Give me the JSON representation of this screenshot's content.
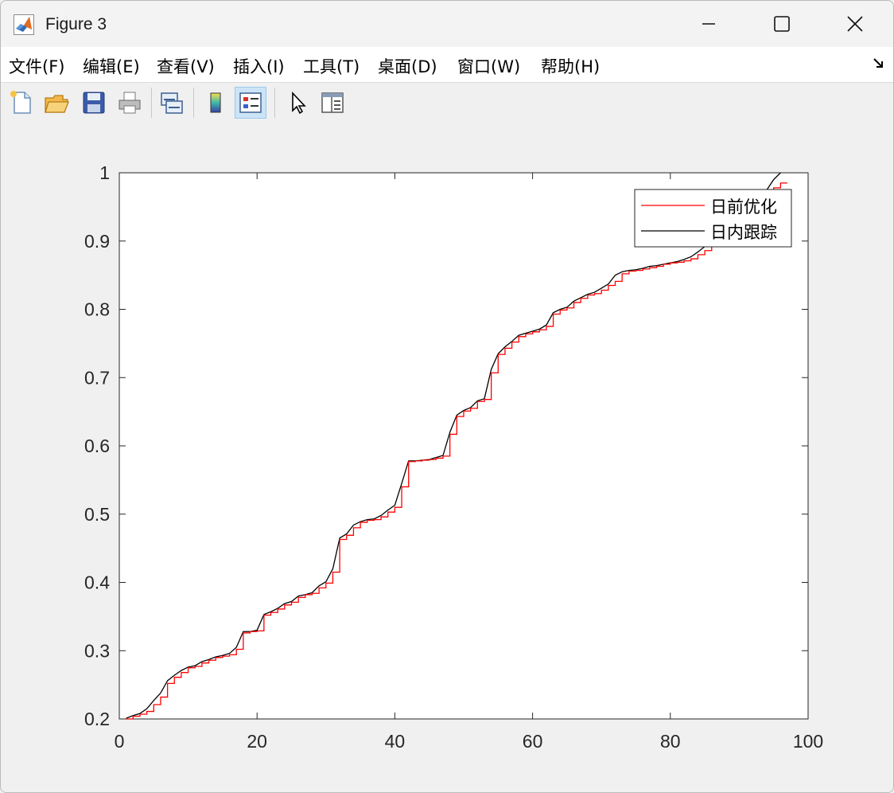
{
  "window": {
    "title": "Figure 3",
    "minimize_icon": "minimize-icon",
    "maximize_icon": "maximize-icon",
    "close_icon": "close-icon"
  },
  "menubar": {
    "items": [
      "文件(F)",
      "编辑(E)",
      "查看(V)",
      "插入(I)",
      "工具(T)",
      "桌面(D)",
      "窗口(W)",
      "帮助(H)"
    ]
  },
  "toolbar": {
    "icons": [
      "new-figure-icon",
      "open-file-icon",
      "save-icon",
      "print-icon",
      "link-plot-icon",
      "colorbar-icon",
      "legend-icon",
      "edit-plot-icon",
      "property-inspector-icon"
    ]
  },
  "chart_data": {
    "type": "line",
    "xlim": [
      0,
      100
    ],
    "ylim": [
      0.2,
      1
    ],
    "xticks": [
      "0",
      "20",
      "40",
      "60",
      "80",
      "100"
    ],
    "yticks": [
      "0.2",
      "0.3",
      "0.4",
      "0.5",
      "0.6",
      "0.7",
      "0.8",
      "0.9",
      "1"
    ],
    "grid": false,
    "legend_position": "top-right",
    "series": [
      {
        "name": "日前优化",
        "color": "#ff0000",
        "style": "stairs",
        "x": [
          1,
          2,
          3,
          4,
          5,
          6,
          7,
          8,
          9,
          10,
          11,
          12,
          13,
          14,
          15,
          16,
          17,
          18,
          19,
          20,
          21,
          22,
          23,
          24,
          25,
          26,
          27,
          28,
          29,
          30,
          31,
          32,
          33,
          34,
          35,
          36,
          37,
          38,
          39,
          40,
          41,
          42,
          43,
          44,
          45,
          46,
          47,
          48,
          49,
          50,
          51,
          52,
          53,
          54,
          55,
          56,
          57,
          58,
          59,
          60,
          61,
          62,
          63,
          64,
          65,
          66,
          67,
          68,
          69,
          70,
          71,
          72,
          73,
          74,
          75,
          76,
          77,
          78,
          79,
          80,
          81,
          82,
          83,
          84,
          85,
          86,
          87,
          88,
          89,
          90,
          91,
          92,
          93,
          94,
          95,
          96
        ],
        "values": [
          0.2,
          0.204,
          0.207,
          0.211,
          0.221,
          0.232,
          0.252,
          0.261,
          0.268,
          0.275,
          0.277,
          0.282,
          0.286,
          0.29,
          0.292,
          0.294,
          0.302,
          0.326,
          0.328,
          0.329,
          0.352,
          0.356,
          0.361,
          0.367,
          0.371,
          0.378,
          0.382,
          0.384,
          0.392,
          0.399,
          0.415,
          0.463,
          0.469,
          0.48,
          0.488,
          0.491,
          0.492,
          0.496,
          0.503,
          0.51,
          0.54,
          0.577,
          0.578,
          0.579,
          0.58,
          0.582,
          0.585,
          0.617,
          0.643,
          0.651,
          0.655,
          0.665,
          0.668,
          0.707,
          0.734,
          0.743,
          0.752,
          0.76,
          0.764,
          0.767,
          0.77,
          0.775,
          0.793,
          0.799,
          0.802,
          0.81,
          0.816,
          0.821,
          0.823,
          0.828,
          0.835,
          0.841,
          0.852,
          0.856,
          0.857,
          0.859,
          0.861,
          0.863,
          0.866,
          0.868,
          0.869,
          0.871,
          0.874,
          0.88,
          0.886,
          0.893,
          0.9,
          0.91,
          0.918,
          0.926,
          0.935,
          0.945,
          0.954,
          0.966,
          0.978,
          0.985
        ]
      },
      {
        "name": "日内跟踪",
        "color": "#000000",
        "style": "line",
        "x": [
          1,
          2,
          3,
          4,
          5,
          6,
          7,
          8,
          9,
          10,
          11,
          12,
          13,
          14,
          15,
          16,
          17,
          18,
          19,
          20,
          21,
          22,
          23,
          24,
          25,
          26,
          27,
          28,
          29,
          30,
          31,
          32,
          33,
          34,
          35,
          36,
          37,
          38,
          39,
          40,
          41,
          42,
          43,
          44,
          45,
          46,
          47,
          48,
          49,
          50,
          51,
          52,
          53,
          54,
          55,
          56,
          57,
          58,
          59,
          60,
          61,
          62,
          63,
          64,
          65,
          66,
          67,
          68,
          69,
          70,
          71,
          72,
          73,
          74,
          75,
          76,
          77,
          78,
          79,
          80,
          81,
          82,
          83,
          84,
          85,
          86,
          87,
          88,
          89,
          90,
          91,
          92,
          93,
          94,
          95,
          96
        ],
        "values": [
          0.201,
          0.205,
          0.208,
          0.215,
          0.227,
          0.238,
          0.256,
          0.264,
          0.271,
          0.276,
          0.278,
          0.284,
          0.287,
          0.291,
          0.293,
          0.296,
          0.305,
          0.328,
          0.328,
          0.33,
          0.353,
          0.357,
          0.362,
          0.369,
          0.372,
          0.38,
          0.382,
          0.385,
          0.395,
          0.401,
          0.42,
          0.465,
          0.471,
          0.484,
          0.489,
          0.492,
          0.493,
          0.498,
          0.506,
          0.513,
          0.545,
          0.578,
          0.578,
          0.579,
          0.58,
          0.583,
          0.586,
          0.62,
          0.645,
          0.652,
          0.656,
          0.666,
          0.669,
          0.712,
          0.735,
          0.745,
          0.753,
          0.762,
          0.765,
          0.768,
          0.771,
          0.777,
          0.795,
          0.8,
          0.803,
          0.812,
          0.817,
          0.822,
          0.825,
          0.831,
          0.837,
          0.85,
          0.855,
          0.857,
          0.858,
          0.86,
          0.863,
          0.864,
          0.866,
          0.868,
          0.87,
          0.873,
          0.877,
          0.884,
          0.892,
          0.899,
          0.908,
          0.917,
          0.925,
          0.934,
          0.944,
          0.952,
          0.962,
          0.975,
          0.99,
          1.0
        ]
      }
    ]
  }
}
